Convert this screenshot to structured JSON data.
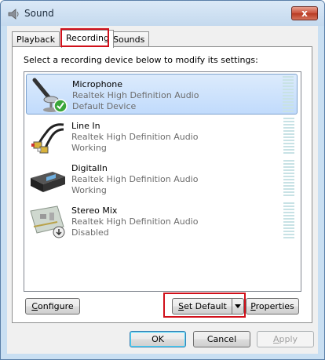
{
  "window": {
    "title": "Sound",
    "close_label": "x"
  },
  "tabs": [
    {
      "label": "Playback"
    },
    {
      "label": "Recording"
    },
    {
      "label": "Sounds"
    }
  ],
  "instruction": "Select a recording device below to modify its settings:",
  "devices": [
    {
      "name": "Microphone",
      "driver": "Realtek High Definition Audio",
      "status": "Default Device",
      "icon": "microphone-icon",
      "selected": true
    },
    {
      "name": "Line In",
      "driver": "Realtek High Definition Audio",
      "status": "Working",
      "icon": "rca-cable-icon"
    },
    {
      "name": "DigitalIn",
      "driver": "Realtek High Definition Audio",
      "status": "Working",
      "icon": "digital-receiver-icon"
    },
    {
      "name": "Stereo Mix",
      "driver": "Realtek High Definition Audio",
      "status": "Disabled",
      "icon": "sound-card-icon"
    }
  ],
  "buttons": {
    "configure": {
      "underlined": "C",
      "rest": "onfigure"
    },
    "set_default": {
      "underlined": "S",
      "rest": "et Default"
    },
    "properties": {
      "underlined": "P",
      "rest": "roperties"
    },
    "ok": "OK",
    "cancel": "Cancel",
    "apply": {
      "underlined": "A",
      "rest": "pply"
    }
  },
  "colors": {
    "highlight": "#d0101a",
    "selection": "#c1dbfc",
    "meter": "#c8e2e5"
  }
}
